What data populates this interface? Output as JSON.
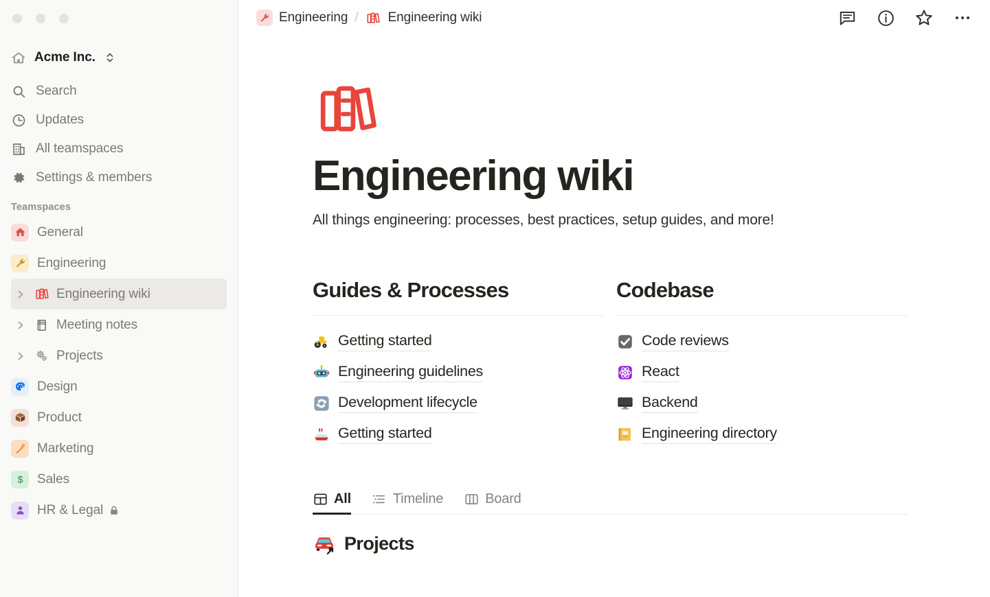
{
  "window": {
    "traffic_lights": [
      "close",
      "minimize",
      "maximize"
    ]
  },
  "sidebar": {
    "workspace": {
      "name": "Acme Inc.",
      "icon": "home-icon",
      "switcher_icon": "chevron-up-down-icon"
    },
    "nav_items": [
      {
        "label": "Search",
        "icon": "search-icon"
      },
      {
        "label": "Updates",
        "icon": "clock-icon"
      },
      {
        "label": "All teamspaces",
        "icon": "building-icon"
      },
      {
        "label": "Settings & members",
        "icon": "gear-icon"
      }
    ],
    "teamspaces_section_title": "Teamspaces",
    "teamspaces": [
      {
        "label": "General",
        "emoji": "🏠",
        "icon_name": "house-emoji",
        "bg": "#fbdcdc"
      },
      {
        "label": "Engineering",
        "emoji": "🔧",
        "icon_name": "wrench-emoji",
        "bg": "#faecc8"
      }
    ],
    "pages": [
      {
        "label": "Engineering wiki",
        "emoji": "📚",
        "icon_name": "books-emoji",
        "selected": true,
        "expandable": true
      },
      {
        "label": "Meeting notes",
        "emoji": "📔",
        "icon_name": "notebook-emoji",
        "selected": false,
        "expandable": true
      },
      {
        "label": "Projects",
        "emoji": "⚙️",
        "icon_name": "gears-emoji",
        "selected": false,
        "expandable": true
      }
    ],
    "teamspaces_rest": [
      {
        "label": "Design",
        "emoji": "🎨",
        "icon_name": "palette-emoji",
        "bg": "#e5eefb"
      },
      {
        "label": "Product",
        "emoji": "📦",
        "icon_name": "package-emoji",
        "bg": "#f2e0d8"
      },
      {
        "label": "Marketing",
        "emoji": "🎤",
        "icon_name": "microphone-emoji",
        "bg": "#fbddc2"
      },
      {
        "label": "Sales",
        "emoji": "💲",
        "icon_name": "dollar-emoji",
        "bg": "#d9efdc"
      },
      {
        "label": "HR & Legal",
        "emoji": "👤",
        "icon_name": "person-emoji",
        "bg": "#e9dcf5",
        "locked": true,
        "lock_icon": "lock-icon"
      }
    ]
  },
  "topbar": {
    "breadcrumb": [
      {
        "label": "Engineering",
        "emoji": "🔧",
        "icon_name": "wrench-emoji",
        "bg": "#fbdcdc"
      },
      {
        "label": "Engineering wiki",
        "emoji": "📚",
        "icon_name": "books-emoji",
        "bg": "transparent"
      }
    ],
    "separator": "/",
    "actions": [
      {
        "name": "comment-icon",
        "label": "Comments"
      },
      {
        "name": "info-icon",
        "label": "Page info"
      },
      {
        "name": "star-icon",
        "label": "Favorite"
      },
      {
        "name": "more-icon",
        "label": "More options"
      }
    ]
  },
  "page": {
    "emoji": "📚",
    "emoji_name": "books-emoji",
    "title": "Engineering wiki",
    "subtitle": "All things engineering: processes, best practices, setup guides, and more!"
  },
  "columns": [
    {
      "heading": "Guides & Processes",
      "links": [
        {
          "label": "Getting started",
          "emoji": "🚜",
          "icon_name": "tractor-emoji"
        },
        {
          "label": "Engineering guidelines",
          "emoji": "🤖",
          "icon_name": "robot-emoji"
        },
        {
          "label": "Development lifecycle",
          "emoji": "🔄",
          "icon_name": "refresh-emoji"
        },
        {
          "label": "Getting started",
          "emoji": "🚢",
          "icon_name": "ship-emoji"
        }
      ]
    },
    {
      "heading": "Codebase",
      "links": [
        {
          "label": "Code reviews",
          "emoji": "✅",
          "icon_name": "check-emoji"
        },
        {
          "label": "React",
          "emoji": "⚛️",
          "icon_name": "atom-emoji"
        },
        {
          "label": "Backend",
          "emoji": "🖥️",
          "icon_name": "desktop-emoji"
        },
        {
          "label": "Engineering directory",
          "emoji": "📒",
          "icon_name": "ledger-emoji"
        }
      ]
    }
  ],
  "view_tabs": [
    {
      "label": "All",
      "icon": "grid-icon",
      "active": true
    },
    {
      "label": "Timeline",
      "icon": "timeline-icon",
      "active": false
    },
    {
      "label": "Board",
      "icon": "board-icon",
      "active": false
    }
  ],
  "database": {
    "title": "Projects",
    "emoji": "🚗",
    "emoji_name": "car-emoji",
    "link_indicator": "arrow-up-right-icon"
  },
  "colors": {
    "accent_red": "#e8453c",
    "sidebar_bg": "#f9f9f8",
    "selected_row": "#ebeae8",
    "text_primary": "#25251f",
    "text_muted": "#7b7a72"
  }
}
